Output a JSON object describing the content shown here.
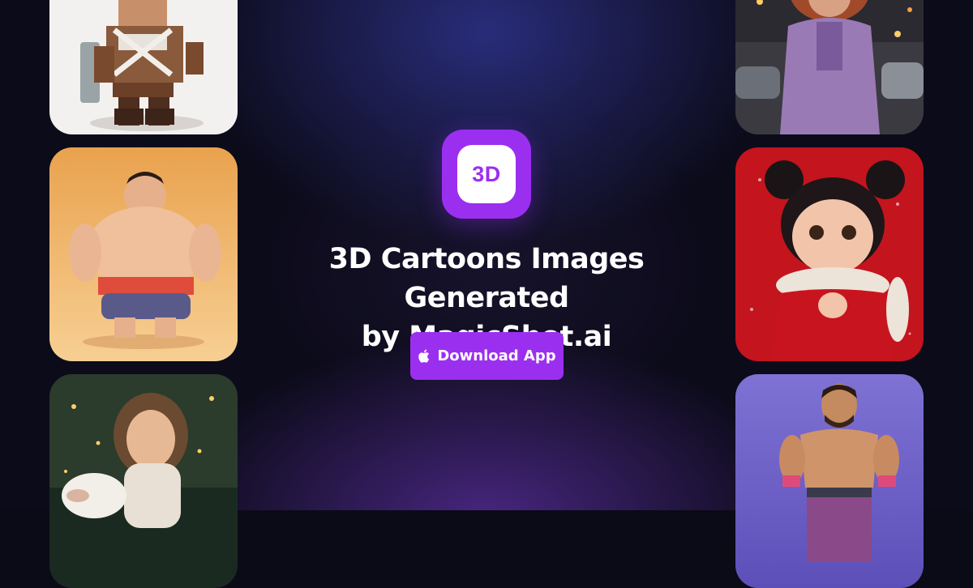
{
  "app_icon": {
    "label": "3D",
    "color": "#9b2ff0"
  },
  "headline": {
    "line1": "3D Cartoons Images Generated",
    "line2": "by MagicShot.ai"
  },
  "cta": {
    "label": "Download App",
    "icon": "apple-icon",
    "color": "#9b2ff0"
  },
  "gallery": {
    "left": [
      "blocky-warrior-image",
      "sumo-wrestler-image",
      "child-with-sheep-image"
    ],
    "right": [
      "curly-hair-girl-image",
      "girl-with-scarf-image",
      "muscular-man-image"
    ]
  }
}
